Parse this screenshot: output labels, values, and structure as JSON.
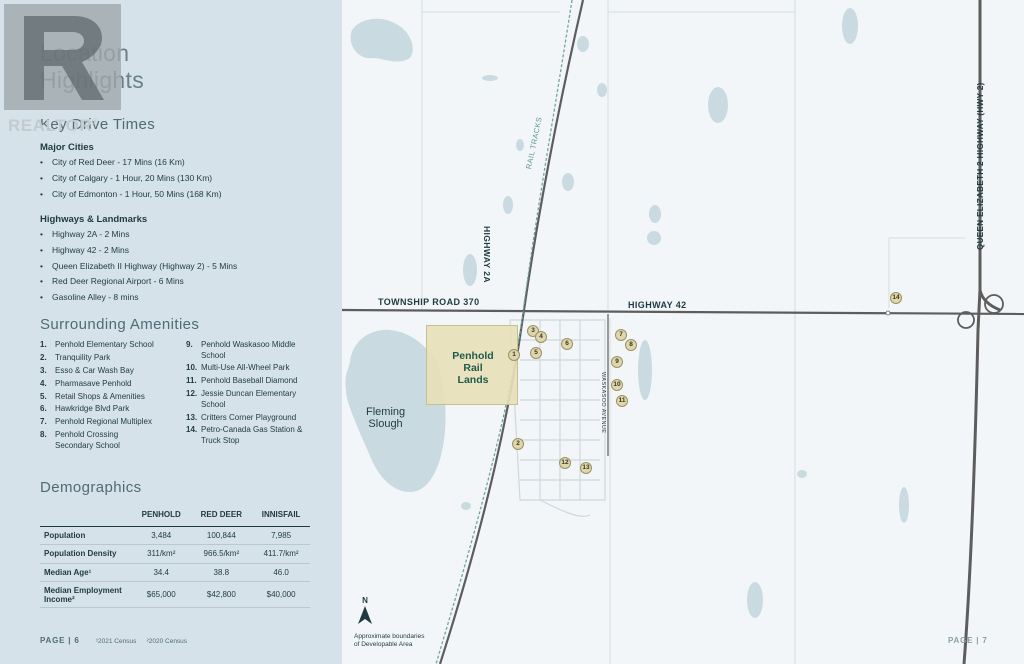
{
  "panel": {
    "title_line1": "Location",
    "title_line2": "Highlights",
    "drive_times_heading": "Key Drive Times",
    "major_cities_heading": "Major Cities",
    "major_cities": [
      "City of Red Deer - 17 Mins (16 Km)",
      "City of Calgary - 1 Hour, 20 Mins (130 Km)",
      "City of Edmonton - 1 Hour, 50 Mins (168 Km)"
    ],
    "highways_heading": "Highways & Landmarks",
    "highways": [
      "Highway 2A - 2 Mins",
      "Highway 42 - 2 Mins",
      "Queen Elizabeth II Highway (Highway 2) -  5 Mins",
      "Red Deer Regional Airport - 6 Mins",
      "Gasoline Alley - 8 mins"
    ],
    "amenities_heading": "Surrounding Amenities",
    "amenities_col1": [
      {
        "num": "1.",
        "label": "Penhold Elementary School"
      },
      {
        "num": "2.",
        "label": "Tranquility Park"
      },
      {
        "num": "3.",
        "label": "Esso & Car Wash Bay"
      },
      {
        "num": "4.",
        "label": "Pharmasave Penhold"
      },
      {
        "num": "5.",
        "label": "Retail Shops & Amenities"
      },
      {
        "num": "6.",
        "label": "Hawkridge Blvd Park"
      },
      {
        "num": "7.",
        "label": "Penhold Regional Multiplex"
      },
      {
        "num": "8.",
        "label": "Penhold Crossing Secondary School"
      }
    ],
    "amenities_col2": [
      {
        "num": "9.",
        "label": "Penhold Waskasoo Middle School"
      },
      {
        "num": "10.",
        "label": "Multi-Use All-Wheel Park"
      },
      {
        "num": "11.",
        "label": "Penhold Baseball Diamond"
      },
      {
        "num": "12.",
        "label": "Jessie Duncan Elementary School"
      },
      {
        "num": "13.",
        "label": "Critters Corner Playground"
      },
      {
        "num": "14.",
        "label": "Petro-Canada Gas Station & Truck Stop"
      }
    ],
    "demographics_heading": "Demographics",
    "demographics": {
      "columns": [
        "",
        "PENHOLD",
        "RED DEER",
        "INNISFAIL"
      ],
      "rows": [
        [
          "Population",
          "3,484",
          "100,844",
          "7,985"
        ],
        [
          "Population Density",
          "311/km²",
          "966.5/km²",
          "411.7/km²"
        ],
        [
          "Median Age¹",
          "34.4",
          "38.8",
          "46.0"
        ],
        [
          "Median Employment Income²",
          "$65,000",
          "$42,800",
          "$40,000"
        ]
      ]
    },
    "page_left": "PAGE | 6",
    "footnote1": "¹2021 Census",
    "footnote2": "²2020 Census"
  },
  "logo": {
    "text": "REALTOR",
    "mark": "®"
  },
  "map": {
    "labels": {
      "township_road": "TOWNSHIP ROAD 370",
      "highway42": "HIGHWAY 42",
      "highway2a": "HIGHWAY 2A",
      "rail_tracks": "RAIL TRACKS",
      "waskasoo": "WASKASOO AVENUE",
      "qe2": "QUEEN ELIZABETH 2 HIGHWAY (HWY 2)",
      "slough_line1": "Fleming",
      "slough_line2": "Slough",
      "penhold_line1": "Penhold",
      "penhold_line2": "Rail",
      "penhold_line3": "Lands",
      "north": "N",
      "approx_line1": "Approximate boundaries",
      "approx_line2": "of Developable Area",
      "page_right": "PAGE | 7"
    },
    "markers": [
      "1",
      "2",
      "3",
      "4",
      "5",
      "6",
      "7",
      "8",
      "9",
      "10",
      "11",
      "12",
      "13",
      "14"
    ],
    "colors": {
      "road": "#5d5d5d",
      "rail": "#6fa6a0",
      "water": "#c9dbe0",
      "developable_area": "#e7e0b8",
      "marker_fill": "#ded7ad"
    }
  }
}
